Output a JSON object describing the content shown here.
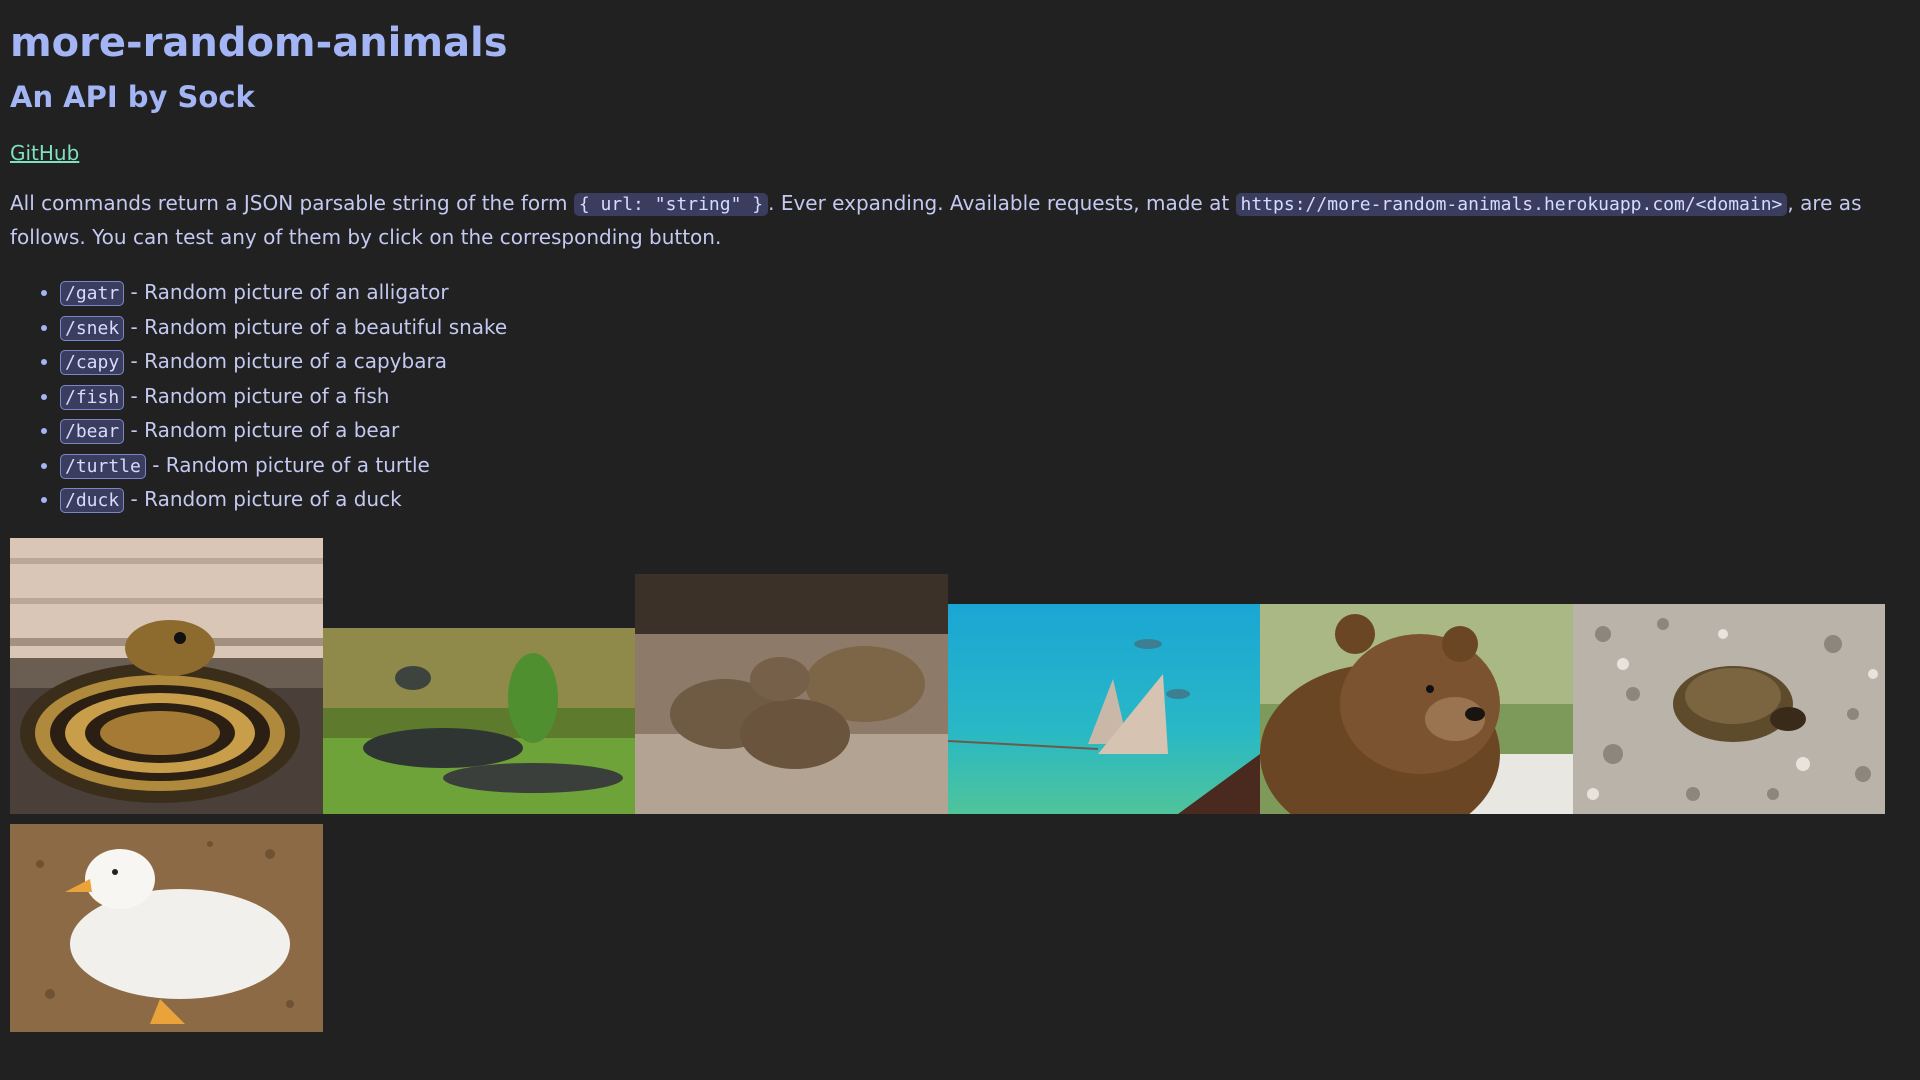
{
  "header": {
    "title": "more-random-animals",
    "subtitle": "An API by Sock",
    "github_link": "GitHub"
  },
  "intro": {
    "text_1": "All commands return a JSON parsable string of the form ",
    "code_form": "{ url: \"string\" }",
    "text_2": ". Ever expanding. Available requests, made at ",
    "code_url": "https://more-random-animals.herokuapp.com/<domain>",
    "text_3": ", are as follows. You can test any of them by click on the corresponding button."
  },
  "endpoints": [
    {
      "cmd": "/gatr",
      "desc": " - Random picture of an alligator"
    },
    {
      "cmd": "/snek",
      "desc": " - Random picture of a beautiful snake"
    },
    {
      "cmd": "/capy",
      "desc": " - Random picture of a capybara"
    },
    {
      "cmd": "/fish",
      "desc": " - Random picture of a fish"
    },
    {
      "cmd": "/bear",
      "desc": " - Random picture of a bear"
    },
    {
      "cmd": "/turtle",
      "desc": " - Random picture of a turtle"
    },
    {
      "cmd": "/duck",
      "desc": " - Random picture of a duck"
    }
  ],
  "gallery": [
    {
      "animal": "snake",
      "icon": "snake-photo"
    },
    {
      "animal": "alligator",
      "icon": "alligator-photo"
    },
    {
      "animal": "capybara",
      "icon": "capybara-photo"
    },
    {
      "animal": "fish",
      "icon": "stingray-photo"
    },
    {
      "animal": "bear",
      "icon": "bear-photo"
    },
    {
      "animal": "turtle",
      "icon": "turtle-photo"
    },
    {
      "animal": "duck",
      "icon": "duck-photo"
    }
  ],
  "colors": {
    "background": "#212121",
    "heading": "#a3b5f5",
    "link": "#7ee0bf",
    "code_bg": "#3a3d5e"
  }
}
